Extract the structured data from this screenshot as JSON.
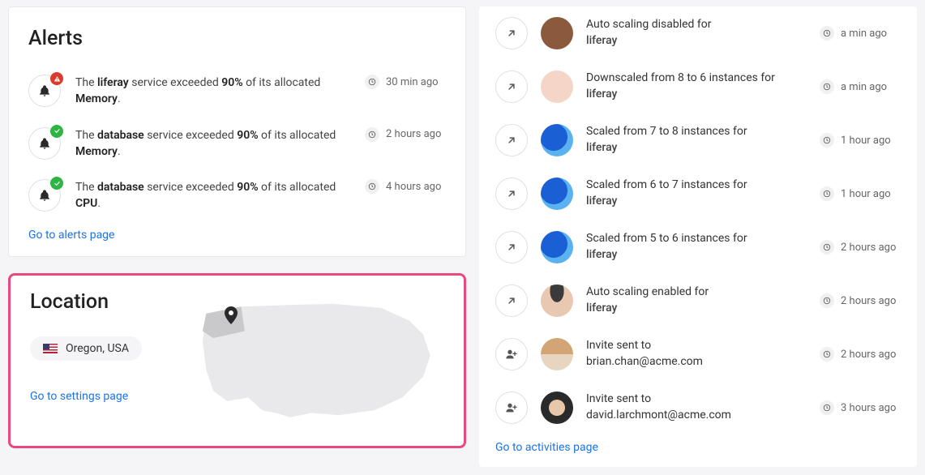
{
  "alerts": {
    "title": "Alerts",
    "items": [
      {
        "prefix": "The ",
        "s1": "liferay",
        "mid": " service exceeded ",
        "pct": "90%",
        "mid2": " of its allocated ",
        "res": "Memory",
        "suffix": ".",
        "time": "30 min ago",
        "status": "warn"
      },
      {
        "prefix": "The ",
        "s1": "database",
        "mid": " service exceeded ",
        "pct": "90%",
        "mid2": " of its allocated ",
        "res": "Memory",
        "suffix": ".",
        "time": "2 hours ago",
        "status": "ok"
      },
      {
        "prefix": "The ",
        "s1": "database",
        "mid": " service exceeded ",
        "pct": "90%",
        "mid2": " of its allocated ",
        "res": "CPU",
        "suffix": ".",
        "time": "4 hours ago",
        "status": "ok"
      }
    ],
    "link": "Go to alerts page"
  },
  "location": {
    "title": "Location",
    "label": "Oregon, USA",
    "link": "Go to settings page"
  },
  "activities": {
    "items": [
      {
        "icon": "arrow-ne",
        "avatar": "a1",
        "line1": "Auto scaling disabled for",
        "line2": "liferay",
        "time": "a min ago",
        "l2class": "l2"
      },
      {
        "icon": "arrow-ne",
        "avatar": "a2",
        "line1": "Downscaled from 8 to 6 instances for",
        "line2": "liferay",
        "time": "a min ago",
        "l2class": "l2"
      },
      {
        "icon": "arrow-ne",
        "avatar": "a3",
        "line1": "Scaled from 7 to 8 instances for",
        "line2": "liferay",
        "time": "1 hour ago",
        "l2class": "l2"
      },
      {
        "icon": "arrow-ne",
        "avatar": "a3",
        "line1": "Scaled from 6 to 7 instances for",
        "line2": "liferay",
        "time": "1 hour ago",
        "l2class": "l2"
      },
      {
        "icon": "arrow-ne",
        "avatar": "a3",
        "line1": "Scaled from 5 to 6 instances for",
        "line2": "liferay",
        "time": "2 hours ago",
        "l2class": "l2"
      },
      {
        "icon": "arrow-ne",
        "avatar": "a4",
        "line1": "Auto scaling enabled for",
        "line2": "liferay",
        "time": "2 hours ago",
        "l2class": "l2"
      },
      {
        "icon": "user-plus",
        "avatar": "a5",
        "line1": "Invite sent to",
        "line2": "brian.chan@acme.com",
        "time": "2 hours ago",
        "l2class": "l2 email"
      },
      {
        "icon": "user-plus",
        "avatar": "a6",
        "line1": "Invite sent to",
        "line2": "david.larchmont@acme.com",
        "time": "3 hours ago",
        "l2class": "l2 email"
      }
    ],
    "link": "Go to activities page"
  }
}
